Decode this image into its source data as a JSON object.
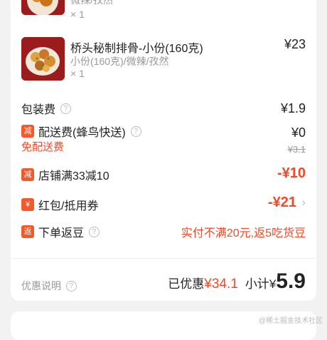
{
  "items": [
    {
      "spec": "微辣/孜然",
      "qty": "× 1"
    },
    {
      "name": "桥头秘制排骨-小份(160克)",
      "spec": "小份(160克)/微辣/孜然",
      "qty": "× 1",
      "price": "¥23"
    }
  ],
  "fees": {
    "packing": {
      "label": "包装费",
      "value": "¥1.9"
    },
    "delivery": {
      "tag": "减",
      "label": "配送费(蜂鸟快送)",
      "value": "¥0",
      "original": "¥3.1",
      "note": "免配送费"
    },
    "shop_discount": {
      "tag": "减",
      "label": "店铺满33减10",
      "value": "-¥10"
    },
    "coupon": {
      "tag": "¥",
      "label": "红包/抵用券",
      "value": "-¥21"
    },
    "cashback": {
      "tag": "返",
      "label": "下单返豆",
      "value": "实付不满20元,返5吃货豆"
    }
  },
  "summary": {
    "info_label": "优惠说明",
    "saved_label": "已优惠",
    "saved_value": "¥34.1",
    "subtotal_label": "小计",
    "subtotal_currency": "¥",
    "subtotal_value": "5.9"
  },
  "watermark": "@稀土掘金技术社区",
  "colors": {
    "accent": "#f04a28",
    "tag": "#f25a2c",
    "muted": "#999999"
  }
}
